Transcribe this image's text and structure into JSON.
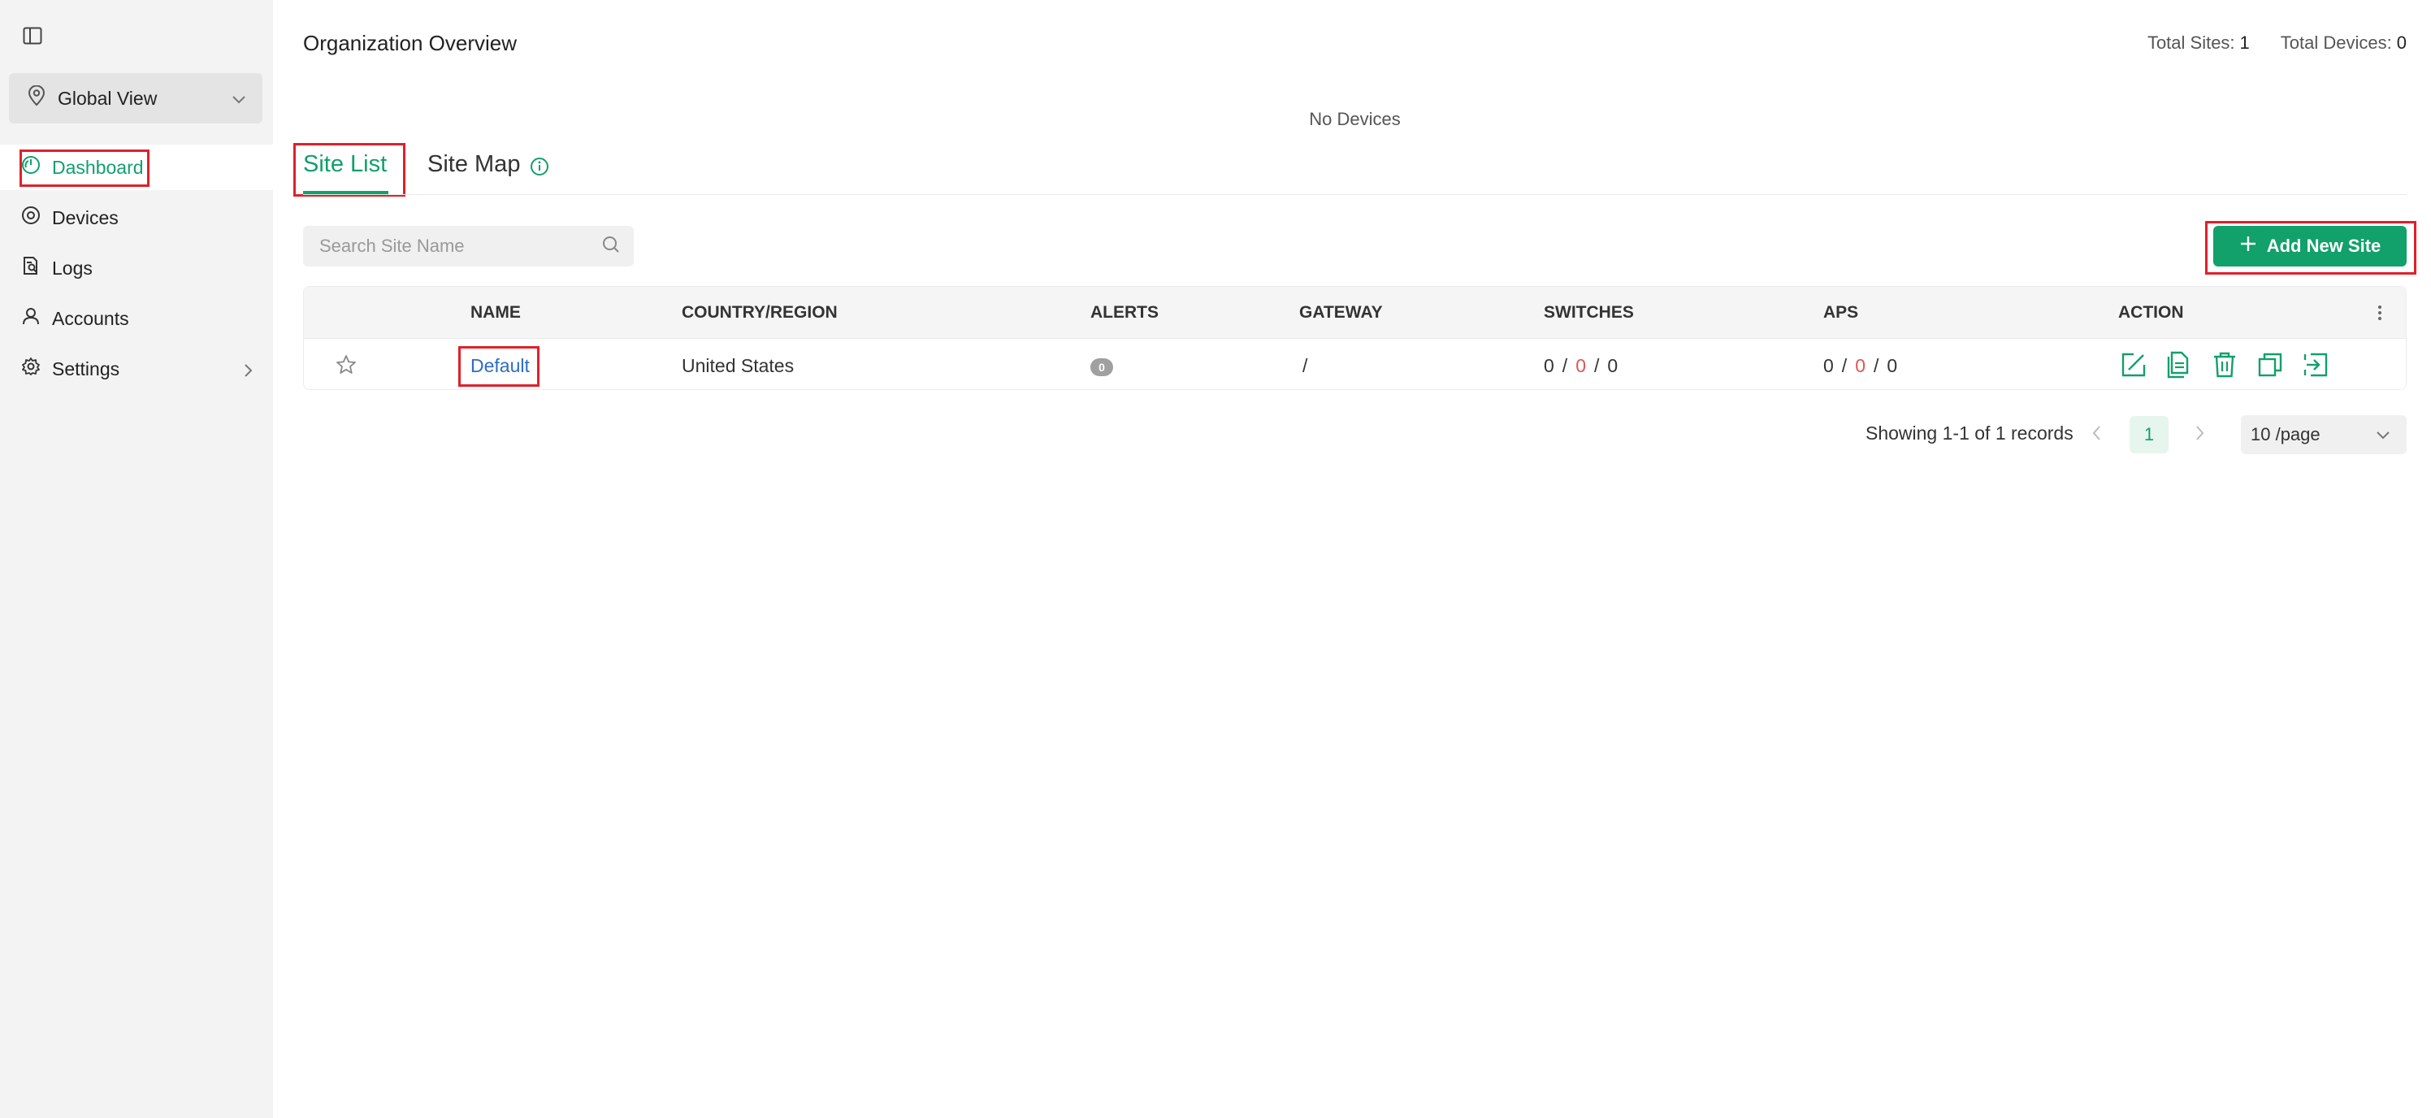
{
  "sidebar": {
    "scope": {
      "label": "Global View"
    },
    "items": [
      {
        "label": "Dashboard",
        "icon": "dashboard-icon"
      },
      {
        "label": "Devices",
        "icon": "devices-icon"
      },
      {
        "label": "Logs",
        "icon": "logs-icon"
      },
      {
        "label": "Accounts",
        "icon": "user-icon"
      },
      {
        "label": "Settings",
        "icon": "gear-icon"
      }
    ]
  },
  "header": {
    "title": "Organization Overview",
    "total_sites_label": "Total Sites:",
    "total_sites": "1",
    "total_devices_label": "Total Devices:",
    "total_devices": "0"
  },
  "summary": {
    "no_devices": "No Devices"
  },
  "tabs": [
    {
      "label": "Site List",
      "active": true
    },
    {
      "label": "Site Map",
      "active": false
    }
  ],
  "search": {
    "placeholder": "Search Site Name",
    "value": ""
  },
  "add_button": {
    "label": "Add New Site"
  },
  "table": {
    "columns": [
      "NAME",
      "COUNTRY/REGION",
      "ALERTS",
      "GATEWAY",
      "SWITCHES",
      "APS",
      "ACTION"
    ],
    "rows": [
      {
        "name": "Default",
        "country": "United States",
        "alerts": "0",
        "gateway": "/",
        "switches": [
          "0",
          "0",
          "0"
        ],
        "aps": [
          "0",
          "0",
          "0"
        ]
      }
    ]
  },
  "pagination": {
    "info": "Showing 1-1 of 1 records",
    "current_page": "1",
    "page_size": "10 /page"
  },
  "colors": {
    "accent": "#12a06b",
    "link": "#2b6cc4",
    "alert_red": "#e05555",
    "highlight_box": "#e0202a"
  }
}
